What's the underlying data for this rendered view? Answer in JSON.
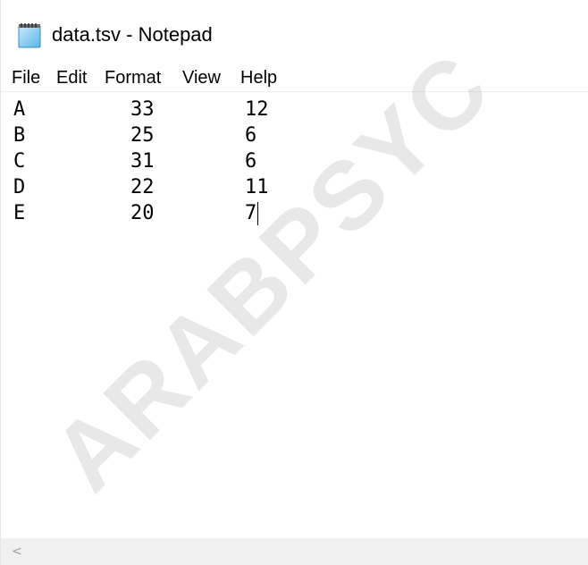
{
  "window": {
    "title": "data.tsv - Notepad",
    "icon": "notepad-icon"
  },
  "menu": [
    "File",
    "Edit",
    "Format",
    "View",
    "Help"
  ],
  "editor": {
    "rows": [
      [
        "A",
        "33",
        "12"
      ],
      [
        "B",
        "25",
        "6"
      ],
      [
        "C",
        "31",
        "6"
      ],
      [
        "D",
        "22",
        "11"
      ],
      [
        "E",
        "20",
        "7"
      ]
    ]
  },
  "watermark": "ARABPSYC",
  "scrollbar": {
    "left_arrow_icon": "chevron-left-icon",
    "left_arrow_glyph": "<"
  }
}
